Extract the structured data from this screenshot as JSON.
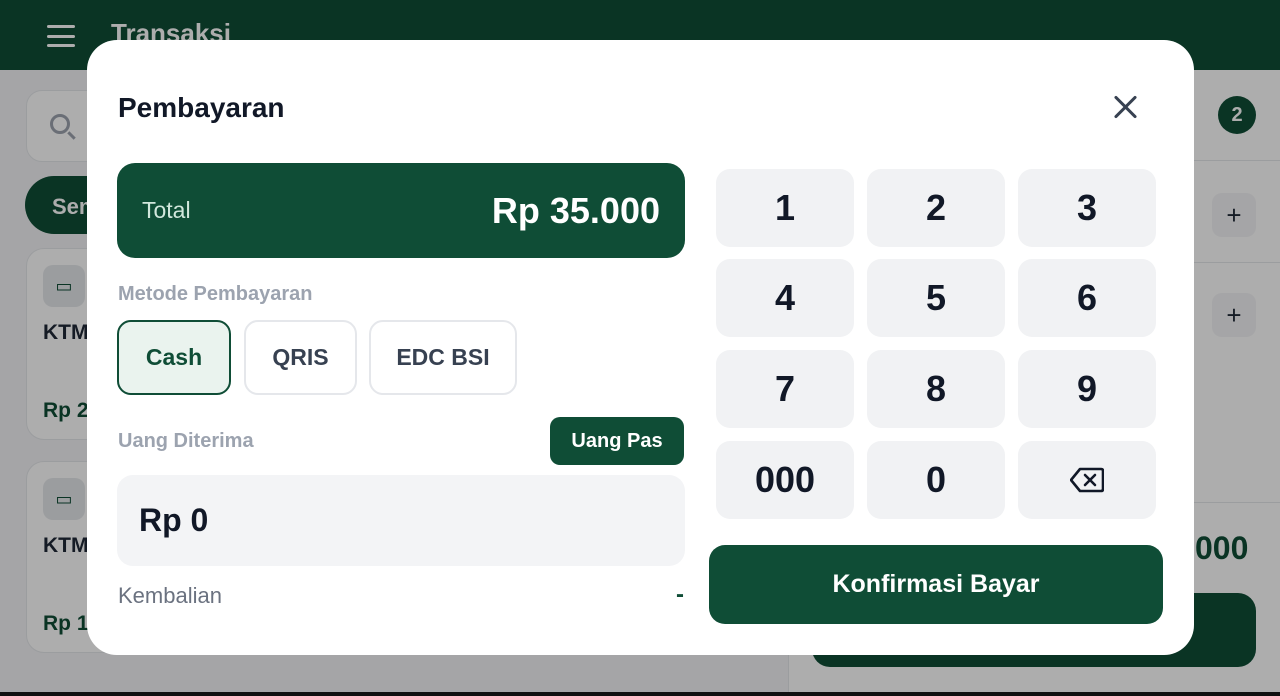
{
  "app": {
    "title": "Transaksi",
    "category_chip": "Sem",
    "cart_count": "2",
    "products": [
      {
        "name": "KTM",
        "price": "Rp 2"
      },
      {
        "name": "KTM",
        "price": "Rp 1"
      }
    ],
    "cart_total_peek": "000",
    "plus_label": "+"
  },
  "modal": {
    "title": "Pembayaran",
    "total_label": "Total",
    "total_value": "Rp 35.000",
    "method_label": "Metode Pembayaran",
    "methods": [
      {
        "label": "Cash",
        "selected": true
      },
      {
        "label": "QRIS",
        "selected": false
      },
      {
        "label": "EDC BSI",
        "selected": false
      }
    ],
    "received_label": "Uang Diterima",
    "exact_button": "Uang Pas",
    "received_value": "Rp 0",
    "change_label": "Kembalian",
    "change_value": "-",
    "keypad": [
      "1",
      "2",
      "3",
      "4",
      "5",
      "6",
      "7",
      "8",
      "9",
      "000",
      "0"
    ],
    "backspace_icon": "backspace-icon",
    "confirm_button": "Konfirmasi Bayar"
  },
  "colors": {
    "primary": "#0f4d36",
    "primary_light": "#eaf3ee",
    "muted": "#9ca3af"
  }
}
